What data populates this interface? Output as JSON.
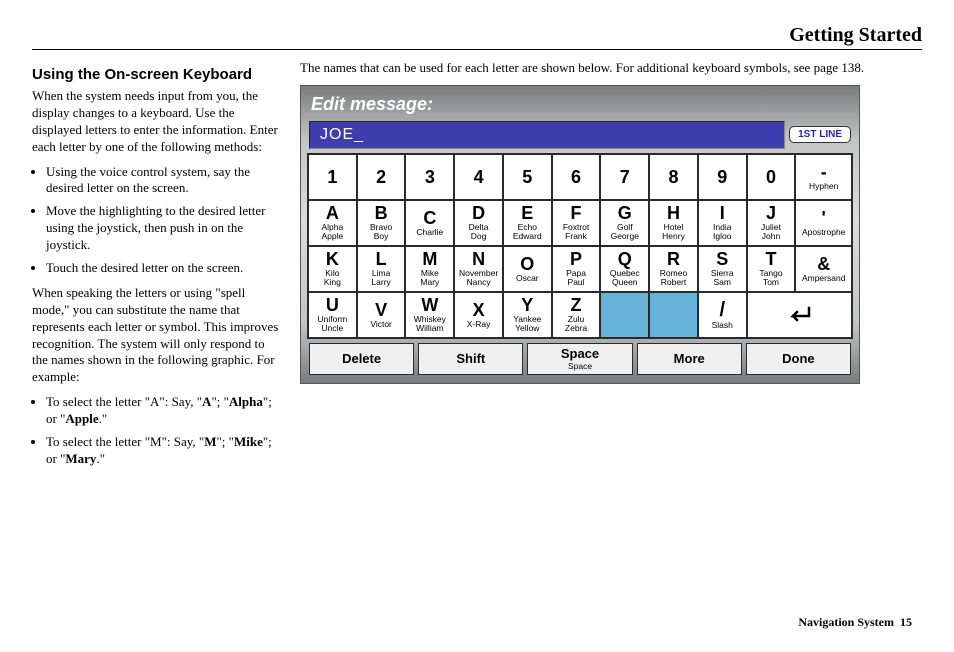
{
  "header": {
    "title": "Getting Started"
  },
  "left": {
    "heading": "Using the On-screen Keyboard",
    "p1": "When the system needs input from you, the display changes to a keyboard. Use the displayed letters to enter the information. Enter each letter by one of the following methods:",
    "bullets1": [
      "Using the voice control system, say the desired letter on the screen.",
      "Move the highlighting to the desired letter using the joystick, then push in on the joystick.",
      "Touch the desired letter on the screen."
    ],
    "p2": "When speaking the letters or using \"spell mode,\" you can substitute the name that represents each letter or symbol. This improves recognition. The system will only respond to the names shown in the following graphic. For example:",
    "exA_pre": "To select the letter \"A\": Say, \"",
    "exA_b1": "A",
    "exA_mid1": "\"; \"",
    "exA_b2": "Alpha",
    "exA_mid2": "\"; or \"",
    "exA_b3": "Apple",
    "exA_end": ".\"",
    "exM_pre": "To select the letter \"M\": Say, \"",
    "exM_b1": "M",
    "exM_mid1": "\"; \"",
    "exM_b2": "Mike",
    "exM_mid2": "\"; or \"",
    "exM_b3": "Mary",
    "exM_end": ".\""
  },
  "right": {
    "intro": "The names that can be used for each letter are shown below. For additional keyboard symbols, see page 138."
  },
  "keyboard": {
    "title": "Edit message:",
    "input": "JOE_",
    "badge": "1ST LINE",
    "numrow": [
      "1",
      "2",
      "3",
      "4",
      "5",
      "6",
      "7",
      "8",
      "9",
      "0"
    ],
    "numsym": {
      "main": "-",
      "sub": "Hyphen"
    },
    "row1": [
      {
        "m": "A",
        "s": "Alpha\nApple"
      },
      {
        "m": "B",
        "s": "Bravo\nBoy"
      },
      {
        "m": "C",
        "s": "Charlie"
      },
      {
        "m": "D",
        "s": "Delta\nDog"
      },
      {
        "m": "E",
        "s": "Echo\nEdward"
      },
      {
        "m": "F",
        "s": "Foxtrot\nFrank"
      },
      {
        "m": "G",
        "s": "Golf\nGeorge"
      },
      {
        "m": "H",
        "s": "Hotel\nHenry"
      },
      {
        "m": "I",
        "s": "India\nIgloo"
      },
      {
        "m": "J",
        "s": "Juliet\nJohn"
      }
    ],
    "row1sym": {
      "main": "'",
      "sub": "Apostrophe"
    },
    "row2": [
      {
        "m": "K",
        "s": "Kilo\nKing"
      },
      {
        "m": "L",
        "s": "Lima\nLarry"
      },
      {
        "m": "M",
        "s": "Mike\nMary"
      },
      {
        "m": "N",
        "s": "November\nNancy"
      },
      {
        "m": "O",
        "s": "Oscar"
      },
      {
        "m": "P",
        "s": "Papa\nPaul"
      },
      {
        "m": "Q",
        "s": "Quebec\nQueen"
      },
      {
        "m": "R",
        "s": "Romeo\nRobert"
      },
      {
        "m": "S",
        "s": "Sierra\nSam"
      },
      {
        "m": "T",
        "s": "Tango\nTom"
      }
    ],
    "row2sym": {
      "main": "&",
      "sub": "Ampersand"
    },
    "row3": [
      {
        "m": "U",
        "s": "Uniform\nUncle"
      },
      {
        "m": "V",
        "s": "Victor"
      },
      {
        "m": "W",
        "s": "Whiskey\nWilliam"
      },
      {
        "m": "X",
        "s": "X-Ray"
      },
      {
        "m": "Y",
        "s": "Yankee\nYellow"
      },
      {
        "m": "Z",
        "s": "Zulu\nZebra"
      },
      {
        "m": "",
        "s": "",
        "empty": true
      },
      {
        "m": "",
        "s": "",
        "empty": true
      },
      {
        "m": "/",
        "s": "Slash"
      }
    ],
    "enter": "↵",
    "bottom": [
      {
        "m": "Delete",
        "s": ""
      },
      {
        "m": "Shift",
        "s": ""
      },
      {
        "m": "Space",
        "s": "Space"
      },
      {
        "m": "More",
        "s": ""
      },
      {
        "m": "Done",
        "s": ""
      }
    ]
  },
  "footer": {
    "label": "Navigation System",
    "page": "15"
  }
}
